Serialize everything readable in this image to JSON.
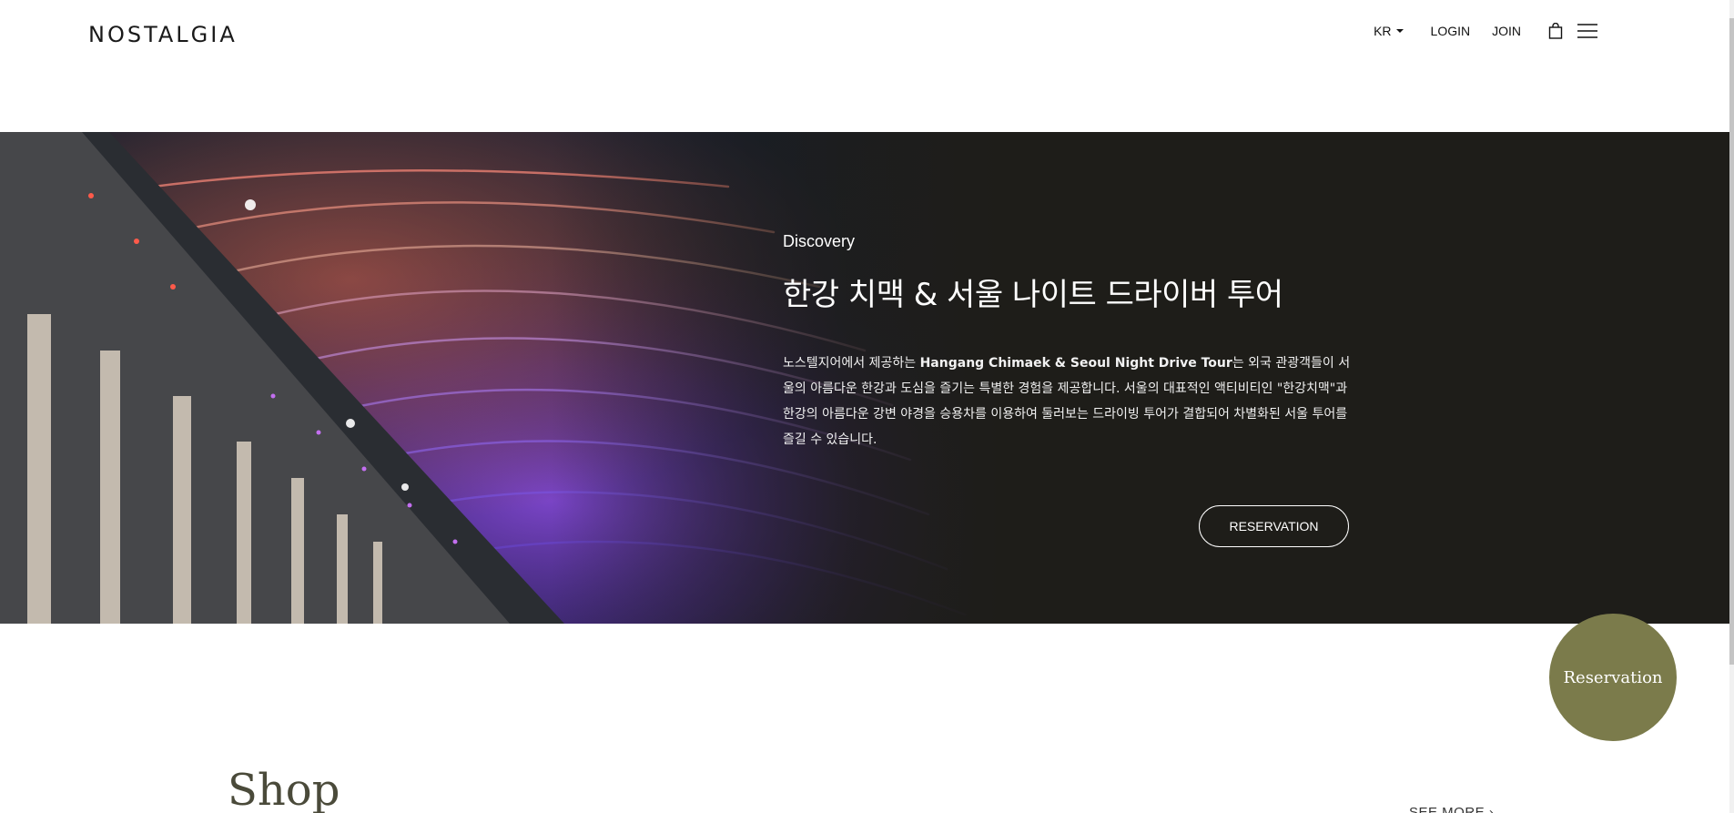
{
  "header": {
    "logo": "NOSTALGIA",
    "language": "KR",
    "login": "LOGIN",
    "join": "JOIN",
    "cart_icon": "shopping-bag-icon",
    "menu_icon": "hamburger-menu-icon"
  },
  "hero": {
    "eyebrow": "Discovery",
    "title": "한강 치맥 & 서울 나이트 드라이버 투어",
    "desc_prefix": "노스텔지어에서 제공하는 ",
    "desc_bold": "Hangang Chimaek & Seoul Night Drive Tour",
    "desc_suffix": "는 외국 관광객들이 서울의 아름다운 한강과 도심을 즐기는 특별한 경험을 제공합니다. 서울의 대표적인 액티비티인 \"한강치맥\"과 한강의 아름다운 강변 야경을 승용차를 이용하여 둘러보는 드라이빙 투어가 결합되어 차별화된 서울 투어를 즐길 수 있습니다.",
    "button": "RESERVATION"
  },
  "floating": {
    "label": "Reservation"
  },
  "shop": {
    "title": "Shop",
    "see_more": "SEE MORE"
  },
  "colors": {
    "hero_bg": "#1e1d19",
    "floating_bg": "#7b7b4b",
    "shop_title": "#4a4a3a"
  }
}
